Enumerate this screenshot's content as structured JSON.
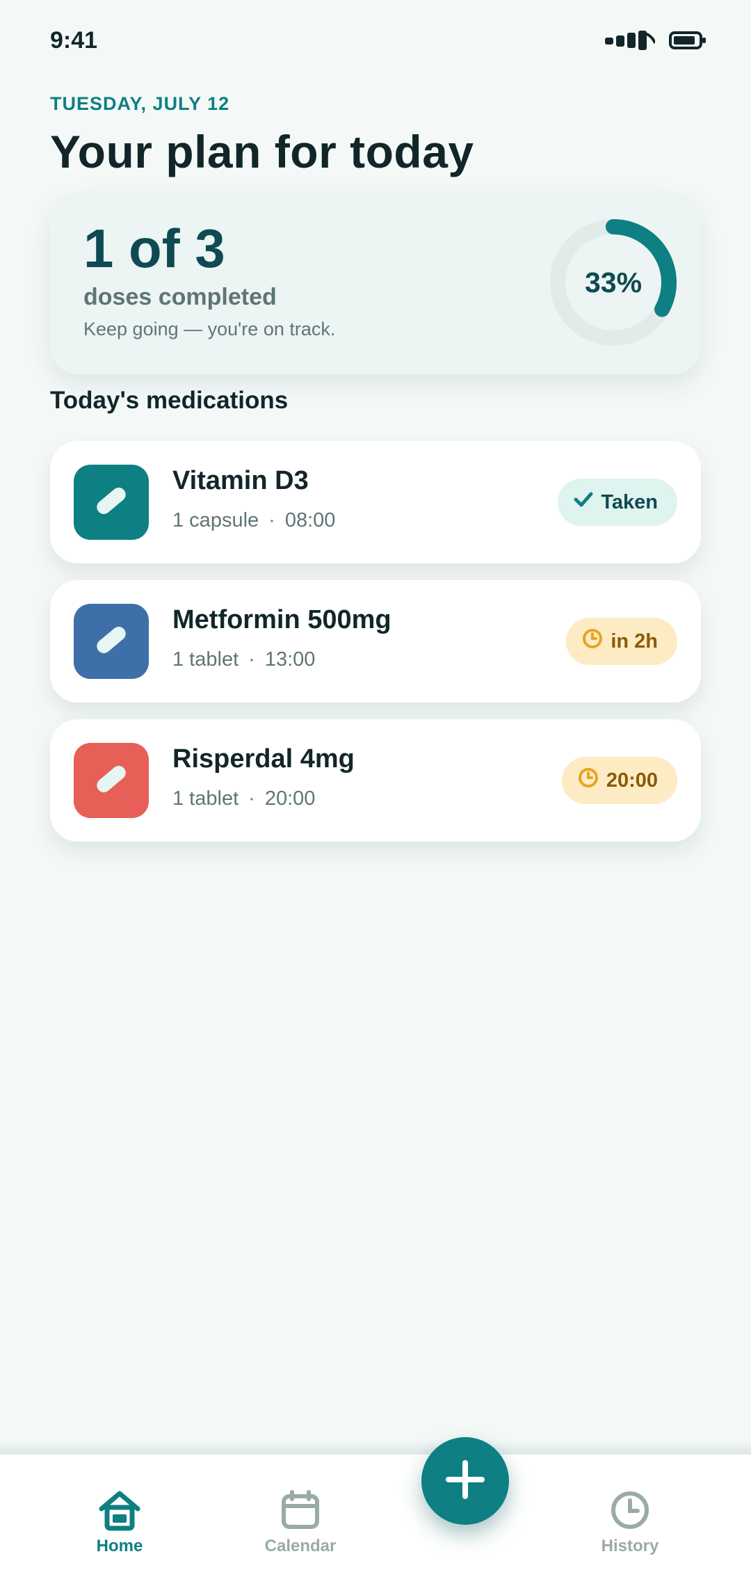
{
  "status_bar": {
    "time": "9:41"
  },
  "header": {
    "date": "TUESDAY, JULY 12",
    "title": "Your plan for today"
  },
  "progress": {
    "count_text": "1 of 3",
    "label": "doses completed",
    "hint": "Keep going — you're on track.",
    "percent_text": "33%",
    "completed": 1,
    "total": 3,
    "fraction": 0.33
  },
  "section": {
    "title": "Today's medications"
  },
  "medications": [
    {
      "name": "Vitamin D3",
      "dose": "1 capsule",
      "separator": "·",
      "time": "08:00",
      "badge": "Taken",
      "status": "taken",
      "icon": "pill-icon",
      "color": "#0e7f82"
    },
    {
      "name": "Metformin 500mg",
      "dose": "1 tablet",
      "separator": "·",
      "time": "13:00",
      "badge": "in 2h",
      "status": "upcoming",
      "icon": "pill-icon",
      "color": "#3e6fa8"
    },
    {
      "name": "Risperdal 4mg",
      "dose": "1 tablet",
      "separator": "·",
      "time": "20:00",
      "badge": "20:00",
      "status": "upcoming",
      "icon": "pill-icon",
      "color": "#e75f57"
    }
  ],
  "nav": {
    "home": "Home",
    "calendar": "Calendar",
    "history": "History",
    "active": "home"
  },
  "colors": {
    "accent": "#0e7f82",
    "background": "#f4f9f8",
    "taken_badge_bg": "#dff3ef",
    "pending_badge_bg": "#fdebc3",
    "pending_icon": "#e8a426"
  }
}
